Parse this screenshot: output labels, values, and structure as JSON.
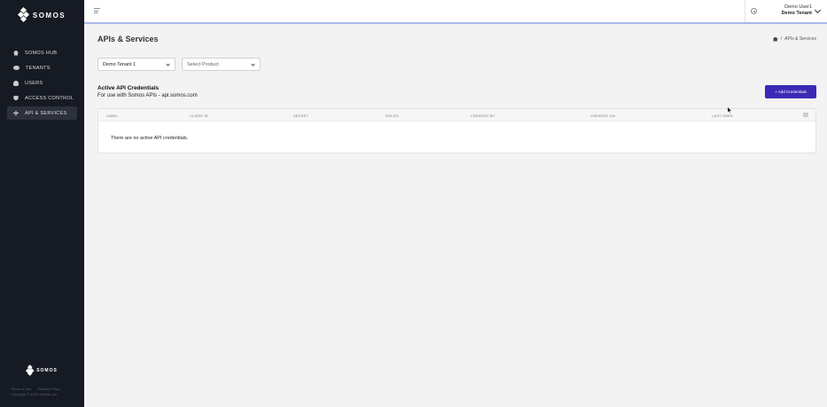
{
  "sidebar": {
    "logo": "SOMOS",
    "items": [
      {
        "label": "SOMOS HUB",
        "icon": "home-icon"
      },
      {
        "label": "TENANTS",
        "icon": "tenants-icon"
      },
      {
        "label": "USERS",
        "icon": "user-icon"
      },
      {
        "label": "ACCESS CONTROL",
        "icon": "shield-icon"
      },
      {
        "label": "API & SERVICES",
        "icon": "plug-icon",
        "active": true
      }
    ],
    "footer_logo": "SOMOS",
    "footer_links": [
      "Terms of Use",
      "Privacy Policy"
    ],
    "copyright": "Copyright © 2020 Somos, Inc."
  },
  "topbar": {
    "user_name": "Demo User1",
    "tenant": "Demo Tenant"
  },
  "page": {
    "title": "APIs & Services",
    "breadcrumb": "APIs & Services"
  },
  "filters": {
    "tenant_value": "Demo Tenant 1",
    "product_placeholder": "Select Product"
  },
  "credentials": {
    "title": "Active API Credentials",
    "subtitle": "For use with Somos APIs - api.somos.com",
    "add_button": "+ Add Credentials",
    "columns": [
      "LABEL",
      "CLIENT ID",
      "SECRET",
      "ROLES",
      "CREATED BY",
      "CREATED ON",
      "LAST USED"
    ],
    "empty_message": "There are no active API credentials."
  }
}
